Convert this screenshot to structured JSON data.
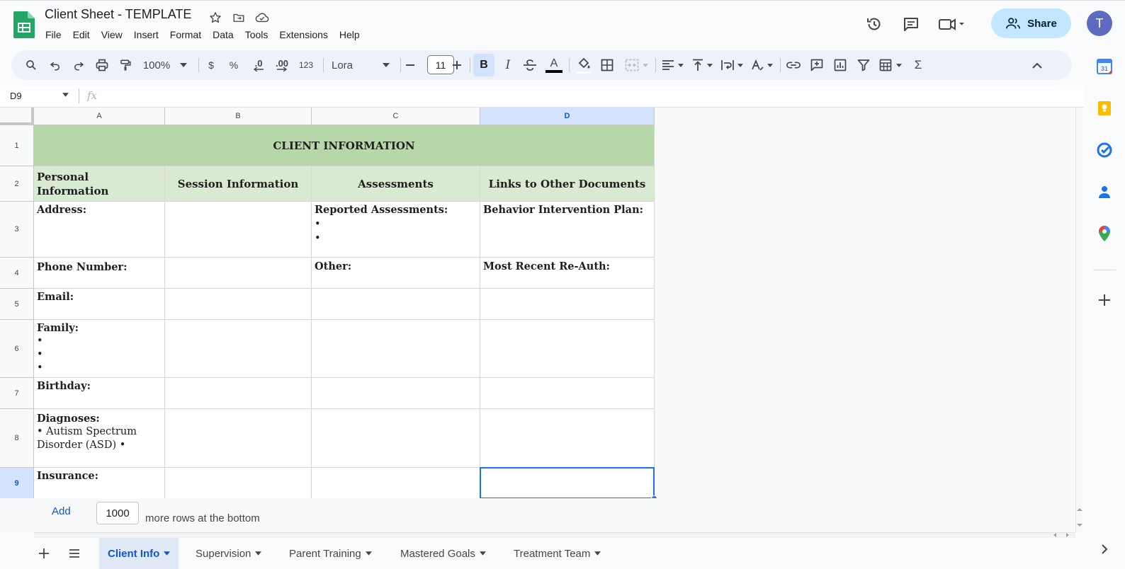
{
  "app": {
    "title": "Client Sheet - TEMPLATE",
    "menu": [
      "File",
      "Edit",
      "View",
      "Insert",
      "Format",
      "Data",
      "Tools",
      "Extensions",
      "Help"
    ],
    "share_label": "Share",
    "avatar_initial": "T",
    "colors": {
      "accent": "#1a73e8",
      "share_bg": "#c2e7ff",
      "header_green": "#b6d7a8",
      "subheader_green": "#d9ead3",
      "avatar": "#5c6bc0"
    }
  },
  "toolbar": {
    "zoom": "100%",
    "currency": "$",
    "percent": "%",
    "dec_decrease": ".0",
    "dec_increase": ".00",
    "number_format": "123",
    "font": "Lora",
    "font_size": "11",
    "bold": "B",
    "italic": "I",
    "text_color_label": "A",
    "sum": "Σ"
  },
  "formula_bar": {
    "name_box": "D9",
    "fx": "fx"
  },
  "columns": [
    "A",
    "B",
    "C",
    "D"
  ],
  "rows": [
    "1",
    "2",
    "3",
    "4",
    "5",
    "6",
    "7",
    "8",
    "9"
  ],
  "sheet": {
    "title": "CLIENT INFORMATION",
    "headers": [
      "Personal Information",
      "Session Information",
      "Assessments",
      "Links to Other Documents"
    ],
    "a3": "Address:",
    "a4": "Phone Number:",
    "a5": "Email:",
    "a6": "Family:",
    "a6_bullets": "•\n•\n•",
    "a7": "Birthday:",
    "a8": "Diagnoses:",
    "a8_body": "• Autism Spectrum Disorder (ASD)\n•",
    "a9": "Insurance:",
    "c3": "Reported Assessments:",
    "c3_bullets": "•\n•",
    "c4": "Other:",
    "d3": "Behavior Intervention Plan:",
    "d4": "Most Recent Re-Auth:"
  },
  "add_rows": {
    "button": "Add",
    "count": "1000",
    "text": "more rows at the bottom"
  },
  "sheet_tabs": [
    "Client Info",
    "Supervision",
    "Parent Training",
    "Mastered Goals",
    "Treatment Team"
  ],
  "side_icons": [
    "calendar-icon",
    "keep-icon",
    "tasks-icon",
    "contacts-icon",
    "maps-icon",
    "add-icon"
  ]
}
